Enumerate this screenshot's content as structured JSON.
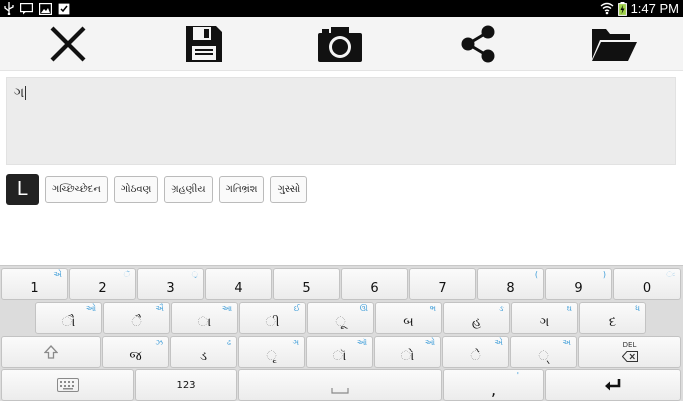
{
  "status_bar": {
    "time": "1:47 PM",
    "left_icons": [
      "usb-icon",
      "notification-icon",
      "image-icon",
      "clipboard-check-icon"
    ],
    "right_icons": [
      "wifi-icon",
      "battery-charging-icon"
    ]
  },
  "toolbar": {
    "buttons": [
      {
        "name": "close-button",
        "icon": "close-icon"
      },
      {
        "name": "save-button",
        "icon": "save-icon"
      },
      {
        "name": "camera-button",
        "icon": "camera-icon"
      },
      {
        "name": "share-button",
        "icon": "share-icon"
      },
      {
        "name": "open-folder-button",
        "icon": "folder-open-icon"
      }
    ]
  },
  "editor": {
    "text": "ગ"
  },
  "suggestions": {
    "lang_key": "L",
    "items": [
      "ગચ્છિચ્છેદન",
      "ગોઠવણ",
      "ગ્રહણીય",
      "ગતિભ્રંશ",
      "ગુસ્સો"
    ]
  },
  "keyboard": {
    "accent_color": "#3a9bd8",
    "row1": [
      {
        "main": "1",
        "hint": "એ"
      },
      {
        "main": "2",
        "hint": "ૅ"
      },
      {
        "main": "3",
        "hint": "્ર"
      },
      {
        "main": "4",
        "hint": ""
      },
      {
        "main": "5",
        "hint": ""
      },
      {
        "main": "6",
        "hint": ""
      },
      {
        "main": "7",
        "hint": ""
      },
      {
        "main": "8",
        "hint": "("
      },
      {
        "main": "9",
        "hint": ")"
      },
      {
        "main": "0",
        "hint": "ઃ"
      }
    ],
    "row2": [
      {
        "main": "ૌ",
        "hint": "ઓ"
      },
      {
        "main": "ૈ",
        "hint": "ઐ"
      },
      {
        "main": "ા",
        "hint": "આ"
      },
      {
        "main": "ી",
        "hint": "ઈ"
      },
      {
        "main": "ૂ",
        "hint": "ઊ"
      },
      {
        "main": "બ",
        "hint": "ભ"
      },
      {
        "main": "હ",
        "hint": "ઙ"
      },
      {
        "main": "ગ",
        "hint": "ઘ"
      },
      {
        "main": "દ",
        "hint": "ધ"
      }
    ],
    "row3": [
      {
        "main": "જ",
        "hint": "ઝ"
      },
      {
        "main": "ડ",
        "hint": "ઢ"
      },
      {
        "main": "ૃ",
        "hint": "ઞ"
      },
      {
        "main": "ૉ",
        "hint": "ઑ"
      },
      {
        "main": "ો",
        "hint": "ઓ"
      },
      {
        "main": "ે",
        "hint": "એ"
      },
      {
        "main": "્",
        "hint": "અ"
      }
    ],
    "del_label": "DEL",
    "numeric_label": "123",
    "comma_label": ",",
    "comma_hint": "'"
  }
}
